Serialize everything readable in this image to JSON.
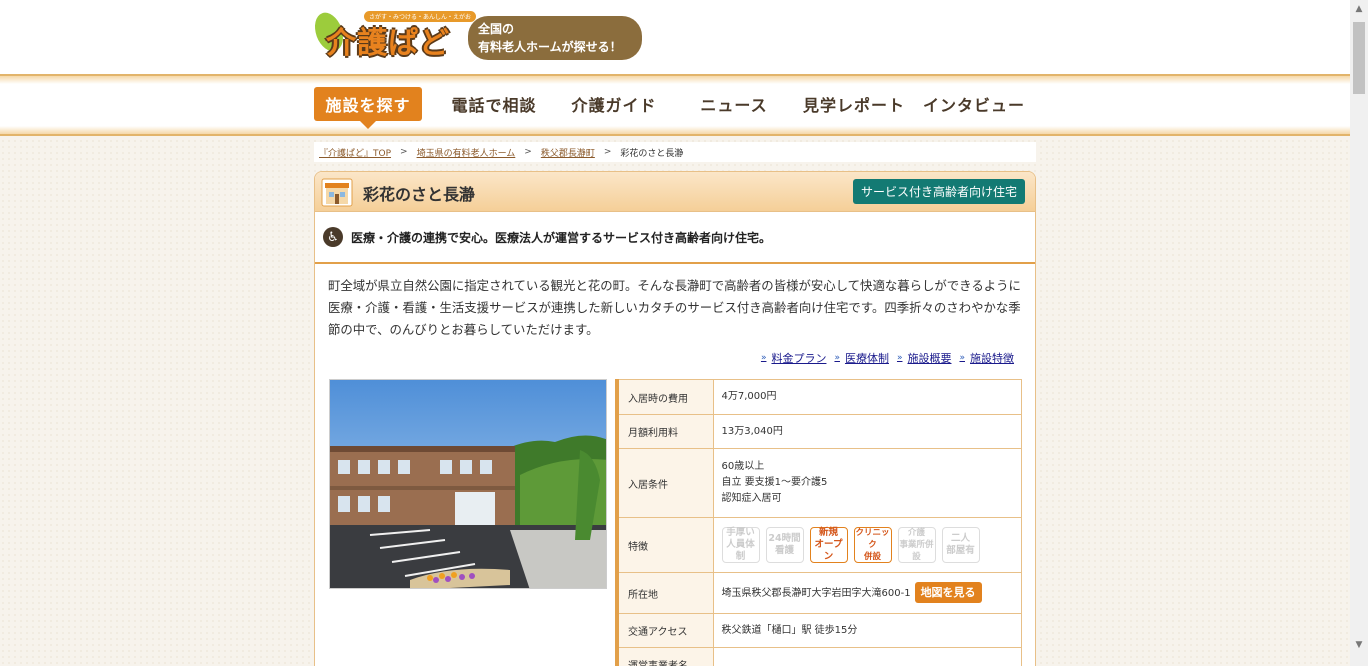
{
  "site": {
    "logo_text": "介護ぱど",
    "logo_tagline": "さがす・みつける・あんしん・えがお",
    "logo_bubble_line1": "全国の",
    "logo_bubble_line2": "有料老人ホームが探せる！"
  },
  "nav": {
    "items": [
      {
        "label": "施設を探す"
      },
      {
        "label": "電話で相談"
      },
      {
        "label": "介護ガイド"
      },
      {
        "label": "ニュース"
      },
      {
        "label": "見学レポート"
      },
      {
        "label": "インタビュー"
      }
    ],
    "active_index": 0
  },
  "breadcrumb": {
    "items": [
      "『介護ぱど』TOP",
      "埼玉県の有料老人ホーム",
      "秩父郡長瀞町"
    ],
    "separator": ">",
    "current": "彩花のさと長瀞"
  },
  "facility": {
    "name": "彩花のさと長瀞",
    "type_badge": "サービス付き高齢者向け住宅",
    "catch": "医療・介護の連携で安心。医療法人が運営するサービス付き高齢者向け住宅。",
    "description": "町全域が県立自然公園に指定されている観光と花の町。そんな長瀞町で高齢者の皆様が安心して快適な暮らしができるように医療・介護・看護・生活支援サービスが連携した新しいカタチのサービス付き高齢者向け住宅です。四季折々のさわやかな季節の中で、のんびりとお暮らしていただけます。",
    "anchors": [
      "料金プラン",
      "医療体制",
      "施設概要",
      "施設特徴"
    ]
  },
  "info": {
    "entry_cost_label": "入居時の費用",
    "entry_cost": "4万7,000円",
    "monthly_label": "月額利用料",
    "monthly": "13万3,040円",
    "conditions_label": "入居条件",
    "conditions": [
      "60歳以上",
      "自立 要支援1～要介護5",
      "認知症入居可"
    ],
    "features_label": "特徴",
    "features": [
      {
        "line1": "手厚い",
        "line2": "人員体制",
        "active": false
      },
      {
        "line1": "24時間",
        "line2": "看護",
        "active": false
      },
      {
        "line1": "新規",
        "line2": "オープン",
        "active": true
      },
      {
        "line1": "クリニック",
        "line2": "併設",
        "active": true
      },
      {
        "line1": "介護",
        "line2": "事業所併設",
        "active": false
      },
      {
        "line1": "二人",
        "line2": "部屋有",
        "active": false
      }
    ],
    "address_label": "所在地",
    "address": "埼玉県秩父郡長瀞町大字岩田字大滝600-1",
    "map_button": "地図を見る",
    "access_label": "交通アクセス",
    "access": "秩父鉄道「樋口」駅 徒歩15分",
    "operator_label": "運営事業者名"
  },
  "colors": {
    "accent": "#e2821e",
    "badge": "#137a73",
    "border": "#e8c088"
  }
}
